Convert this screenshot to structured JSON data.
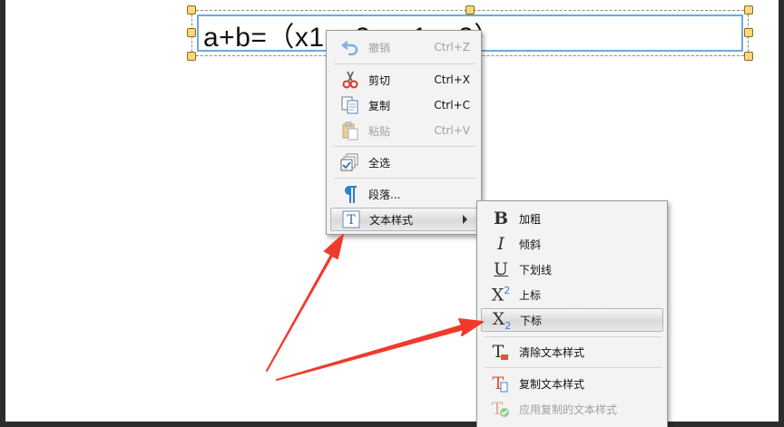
{
  "document": {
    "formula_text": "a+b=（x1+x2，y1+y2）"
  },
  "context_menu": {
    "items": [
      {
        "label": "撤销",
        "shortcut": "Ctrl+Z",
        "icon": "undo-icon",
        "enabled": false
      },
      {
        "label": "剪切",
        "shortcut": "Ctrl+X",
        "icon": "scissors-icon",
        "enabled": true
      },
      {
        "label": "复制",
        "shortcut": "Ctrl+C",
        "icon": "copy-icon",
        "enabled": true
      },
      {
        "label": "粘贴",
        "shortcut": "Ctrl+V",
        "icon": "paste-icon",
        "enabled": false
      },
      {
        "label": "全选",
        "shortcut": "",
        "icon": "select-all-icon",
        "enabled": true
      },
      {
        "label": "段落...",
        "shortcut": "",
        "icon": "paragraph-icon",
        "enabled": true
      },
      {
        "label": "文本样式",
        "shortcut": "",
        "icon": "text-style-icon",
        "enabled": true,
        "highlighted": true,
        "has_submenu": true
      }
    ]
  },
  "submenu": {
    "items": [
      {
        "label": "加粗",
        "icon": "bold-icon",
        "glyph": "B"
      },
      {
        "label": "倾斜",
        "icon": "italic-icon",
        "glyph": "I"
      },
      {
        "label": "下划线",
        "icon": "underline-icon",
        "glyph": "U"
      },
      {
        "label": "上标",
        "icon": "superscript-icon",
        "glyph": "X",
        "mark": "2"
      },
      {
        "label": "下标",
        "icon": "subscript-icon",
        "glyph": "X",
        "mark": "2",
        "highlighted": true
      },
      {
        "label": "清除文本样式",
        "icon": "clear-text-style-icon",
        "glyph": "T"
      },
      {
        "label": "复制文本样式",
        "icon": "copy-text-style-icon",
        "glyph": "T"
      },
      {
        "label": "应用复制的文本样式",
        "icon": "apply-text-style-icon",
        "glyph": "T",
        "enabled": false
      }
    ]
  },
  "colors": {
    "annotation_arrow": "#f03a2a",
    "selection_border": "#6fa8dc",
    "handle_fill": "#ffd77a",
    "disabled_text": "#a0a0a0"
  }
}
